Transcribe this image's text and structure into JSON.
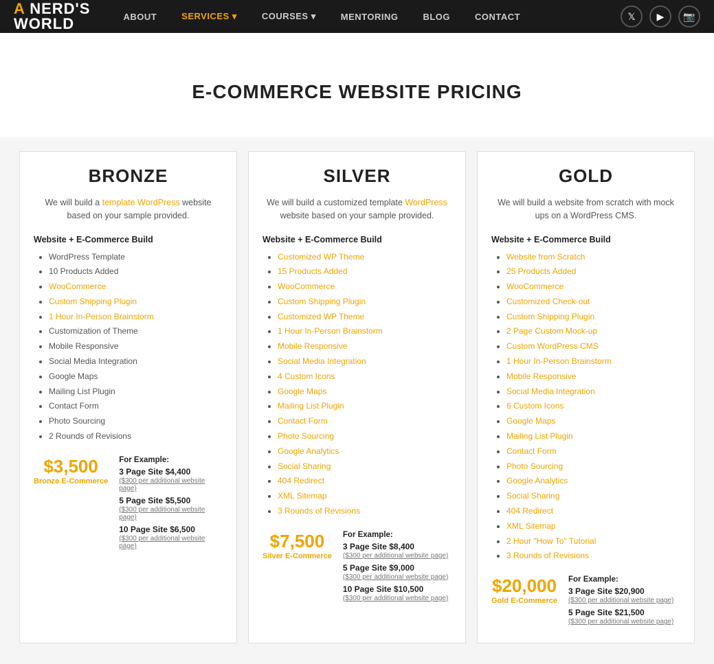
{
  "nav": {
    "logo_line1": "A Nerd's",
    "logo_line2": "World",
    "links": [
      {
        "label": "ABOUT",
        "active": false
      },
      {
        "label": "SERVICES ▾",
        "active": true
      },
      {
        "label": "COURSES ▾",
        "active": false
      },
      {
        "label": "MENTORING",
        "active": false
      },
      {
        "label": "BLOG",
        "active": false
      },
      {
        "label": "CONTACT",
        "active": false
      }
    ],
    "icons": [
      "twitter",
      "youtube",
      "instagram"
    ]
  },
  "page": {
    "title": "E-COMMERCE WEBSITE PRICING"
  },
  "bronze": {
    "title": "BRONZE",
    "description": "We will build a template WordPress website based on your sample provided.",
    "section_label": "Website + E-Commerce Build",
    "features": [
      "WordPress Template",
      "10 Products Added",
      "WooCommerce",
      "Custom Shipping Plugin",
      "1 Hour In-Person Brainstorm",
      "Customization of Theme",
      "Mobile Responsive",
      "Social Media Integration",
      "Google Maps",
      "Mailing List Plugin",
      "Contact Form",
      "Photo Sourcing",
      "2 Rounds of Revisions"
    ],
    "price": "$3,500",
    "price_label": "Bronze E-Commerce",
    "examples_label": "For Example:",
    "examples": [
      {
        "label": "3 Page Site $4,400",
        "sub": "($300 per additional website page)"
      },
      {
        "label": "5 Page Site $5,500",
        "sub": "($300 per additional website page)"
      },
      {
        "label": "10 Page Site $6,500",
        "sub": "($300 per additional website page)"
      }
    ]
  },
  "silver": {
    "title": "SILVER",
    "description": "We will build a customized template WordPress website based on your sample provided.",
    "section_label": "Website + E-Commerce Build",
    "features": [
      "Customized WP Theme",
      "15 Products Added",
      "WooCommerce",
      "Custom Shipping Plugin",
      "Customized WP Theme",
      "1 Hour In-Person Brainstorm",
      "Mobile Responsive",
      "Social Media Integration",
      "4 Custom Icons",
      "Google Maps",
      "Mailing List Plugin",
      "Contact Form",
      "Photo Sourcing",
      "Google Analytics",
      "Social Sharing",
      "404 Redirect",
      "XML Sitemap",
      "3 Rounds of Revisions"
    ],
    "price": "$7,500",
    "price_label": "Silver E-Commerce",
    "examples_label": "For Example:",
    "examples": [
      {
        "label": "3 Page Site $8,400",
        "sub": "($300 per additional website page)"
      },
      {
        "label": "5 Page Site $9,000",
        "sub": "($300 per additional website page)"
      },
      {
        "label": "10 Page Site $10,500",
        "sub": "($300 per additional website page)"
      }
    ]
  },
  "gold": {
    "title": "GOLD",
    "description": "We will build a website from scratch with mock ups on a WordPress CMS.",
    "section_label": "Website + E-Commerce Build",
    "features": [
      "Website from Scratch",
      "25 Products Added",
      "WooCommerce",
      "Customized Check-out",
      "Custom Shipping Plugin",
      "2 Page Custom Mock-up",
      "Custom WordPress CMS",
      "1 Hour In-Person Brainstorm",
      "Mobile Responsive",
      "Social Media Integration",
      "6 Custom Icons",
      "Google Maps",
      "Mailing List Plugin",
      "Contact Form",
      "Photo Sourcing",
      "Google Analytics",
      "Social Sharing",
      "404 Redirect",
      "XML Sitemap",
      "2 Hour \"How To\" Tutorial",
      "3 Rounds of Revisions"
    ],
    "price": "$20,000",
    "price_label": "Gold E-Commerce",
    "examples_label": "For Example:",
    "examples": [
      {
        "label": "3 Page Site $20,900",
        "sub": "($300 per additional website page)"
      },
      {
        "label": "5 Page Site $21,500",
        "sub": "($300 per additional website page)"
      }
    ]
  }
}
